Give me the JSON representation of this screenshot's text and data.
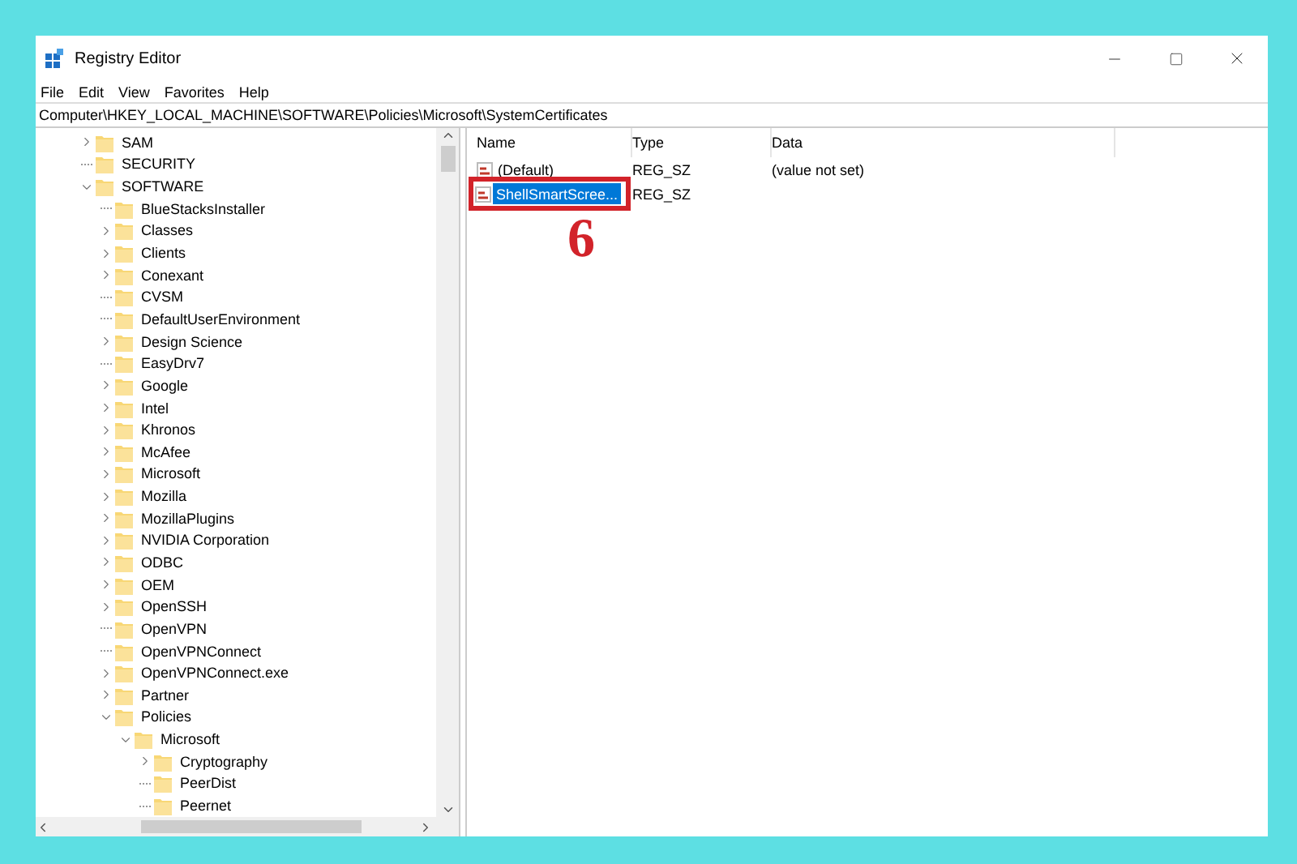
{
  "window": {
    "title": "Registry Editor"
  },
  "menu": [
    "File",
    "Edit",
    "View",
    "Favorites",
    "Help"
  ],
  "address": "Computer\\HKEY_LOCAL_MACHINE\\SOFTWARE\\Policies\\Microsoft\\SystemCertificates",
  "tree": [
    {
      "label": "SAM",
      "kind": "node",
      "expanded": false
    },
    {
      "label": "SECURITY",
      "kind": "leaf"
    },
    {
      "label": "SOFTWARE",
      "kind": "node",
      "expanded": true,
      "children": [
        {
          "label": "BlueStacksInstaller",
          "kind": "leaf"
        },
        {
          "label": "Classes",
          "kind": "node",
          "expanded": false
        },
        {
          "label": "Clients",
          "kind": "node",
          "expanded": false
        },
        {
          "label": "Conexant",
          "kind": "node",
          "expanded": false
        },
        {
          "label": "CVSM",
          "kind": "leaf"
        },
        {
          "label": "DefaultUserEnvironment",
          "kind": "leaf"
        },
        {
          "label": "Design Science",
          "kind": "node",
          "expanded": false
        },
        {
          "label": "EasyDrv7",
          "kind": "leaf"
        },
        {
          "label": "Google",
          "kind": "node",
          "expanded": false
        },
        {
          "label": "Intel",
          "kind": "node",
          "expanded": false
        },
        {
          "label": "Khronos",
          "kind": "node",
          "expanded": false
        },
        {
          "label": "McAfee",
          "kind": "node",
          "expanded": false
        },
        {
          "label": "Microsoft",
          "kind": "node",
          "expanded": false
        },
        {
          "label": "Mozilla",
          "kind": "node",
          "expanded": false
        },
        {
          "label": "MozillaPlugins",
          "kind": "node",
          "expanded": false
        },
        {
          "label": "NVIDIA Corporation",
          "kind": "node",
          "expanded": false
        },
        {
          "label": "ODBC",
          "kind": "node",
          "expanded": false
        },
        {
          "label": "OEM",
          "kind": "node",
          "expanded": false
        },
        {
          "label": "OpenSSH",
          "kind": "node",
          "expanded": false
        },
        {
          "label": "OpenVPN",
          "kind": "leaf"
        },
        {
          "label": "OpenVPNConnect",
          "kind": "leaf"
        },
        {
          "label": "OpenVPNConnect.exe",
          "kind": "node",
          "expanded": false
        },
        {
          "label": "Partner",
          "kind": "node",
          "expanded": false
        },
        {
          "label": "Policies",
          "kind": "node",
          "expanded": true,
          "children": [
            {
              "label": "Microsoft",
              "kind": "node",
              "expanded": true,
              "children": [
                {
                  "label": "Cryptography",
                  "kind": "node",
                  "expanded": false
                },
                {
                  "label": "PeerDist",
                  "kind": "leaf"
                },
                {
                  "label": "Peernet",
                  "kind": "leaf"
                }
              ]
            }
          ]
        }
      ]
    }
  ],
  "columns": [
    "Name",
    "Type",
    "Data"
  ],
  "values": [
    {
      "name": "(Default)",
      "type": "REG_SZ",
      "data": "(value not set)",
      "selected": false
    },
    {
      "name": "ShellSmartScree...",
      "type": "REG_SZ",
      "selected": true
    }
  ],
  "annotation": {
    "label": "6"
  }
}
